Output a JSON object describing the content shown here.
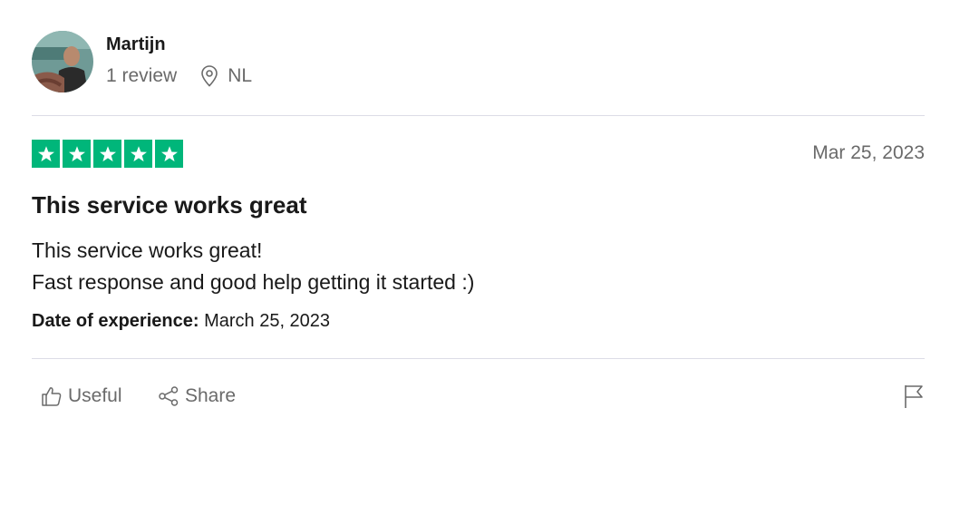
{
  "reviewer": {
    "name": "Martijn",
    "review_count": "1 review",
    "country": "NL"
  },
  "review": {
    "rating": 5,
    "date": "Mar 25, 2023",
    "title": "This service works great",
    "body_lines": [
      "This service works great!",
      "Fast response and good help getting it started :)"
    ],
    "experience_label": "Date of experience:",
    "experience_date": "March 25, 2023"
  },
  "actions": {
    "useful_label": "Useful",
    "share_label": "Share"
  },
  "icons": {
    "location": "location-pin-icon",
    "useful": "thumbs-up-icon",
    "share": "share-icon",
    "flag": "flag-icon",
    "star": "star-icon"
  },
  "colors": {
    "star_green": "#00b67a",
    "muted_text": "#6a6a6a",
    "divider": "#dcdce6"
  }
}
